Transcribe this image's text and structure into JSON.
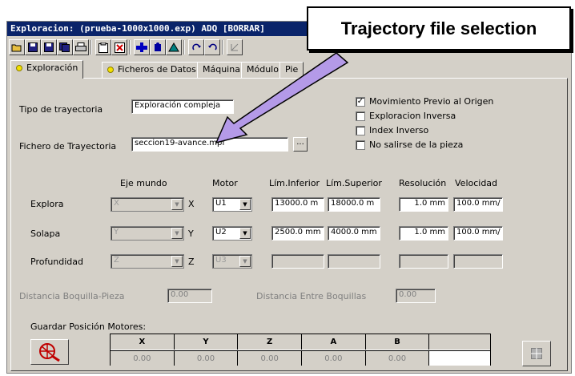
{
  "window": {
    "title": "Exploracion: (prueba-1000x1000.exp) ADQ [BORRAR]"
  },
  "callout": {
    "text": "Trajectory file selection"
  },
  "toolbar": {
    "icons": [
      "open-folder-icon",
      "save-icon",
      "save-as-icon",
      "save-all-icon",
      "print-icon",
      "clipboard-icon",
      "delete-icon",
      "machine-icon",
      "start-icon",
      "tool-icon",
      "redo-icon",
      "undo-icon",
      "measure-icon"
    ]
  },
  "tabs": [
    {
      "label": "Exploración",
      "has_dot": true
    },
    {
      "label": "Ficheros de Datos",
      "has_dot": true
    },
    {
      "label": "Máquina",
      "has_dot": false
    },
    {
      "label": "Módulo",
      "has_dot": false
    },
    {
      "label": "Pie",
      "has_dot": false
    }
  ],
  "form": {
    "trajectory_type_label": "Tipo de trayectoria",
    "trajectory_type_value": "Exploración compleja",
    "trajectory_file_label": "Fichero de Trayectoria",
    "trajectory_file_value": "seccion19-avance.mpf",
    "browse_label": "...",
    "checkboxes": [
      {
        "label": "Movimiento Previo al Origen",
        "checked": true
      },
      {
        "label": "Exploracion Inversa",
        "checked": false
      },
      {
        "label": "Index Inverso",
        "checked": false
      },
      {
        "label": "No salirse de la pieza",
        "checked": false
      }
    ]
  },
  "axes_table": {
    "headers": {
      "world": "Eje mundo",
      "motor": "Motor",
      "lower": "Lím.Inferior",
      "upper": "Lím.Superior",
      "resolution": "Resolución",
      "speed": "Velocidad"
    },
    "rows": [
      {
        "label": "Explora",
        "world": "X",
        "axis": "X",
        "motor": "U1",
        "lower": "13000.0 m",
        "upper": "18000.0 m",
        "resolution": "1.0 mm",
        "speed": "100.0 mm/"
      },
      {
        "label": "Solapa",
        "world": "Y",
        "axis": "Y",
        "motor": "U2",
        "lower": "2500.0 mm",
        "upper": "4000.0 mm",
        "resolution": "1.0 mm",
        "speed": "100.0 mm/"
      },
      {
        "label": "Profundidad",
        "world": "Z",
        "axis": "Z",
        "motor": "U3",
        "lower": "",
        "upper": "",
        "resolution": "",
        "speed": ""
      }
    ]
  },
  "distances": {
    "nozzle_part_label": "Distancia Boquilla-Pieza",
    "nozzle_part_value": "0.00",
    "between_nozzles_label": "Distancia Entre Boquillas",
    "between_nozzles_value": "0.00"
  },
  "positions": {
    "label": "Guardar Posición Motores:",
    "headers": [
      "X",
      "Y",
      "Z",
      "A",
      "B"
    ],
    "values": [
      "0.00",
      "0.00",
      "0.00",
      "0.00",
      "0.00"
    ]
  }
}
